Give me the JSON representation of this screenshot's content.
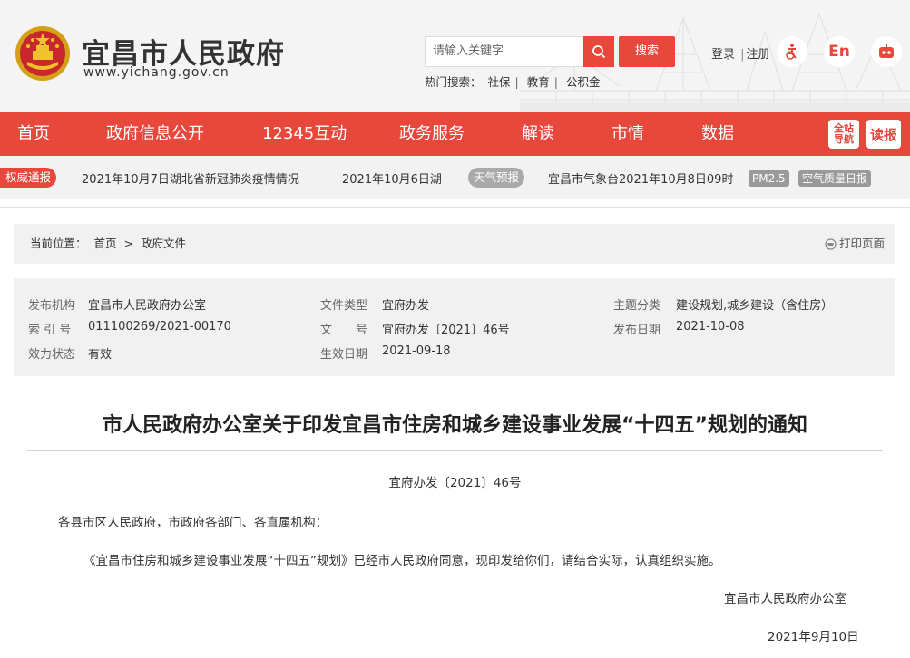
{
  "site": {
    "title": "宜昌市人民政府",
    "url": "www.yichang.gov.cn"
  },
  "search": {
    "placeholder": "请输入关键字",
    "button": "搜索"
  },
  "hot": {
    "label": "热门搜索：",
    "items": [
      "社保",
      "教育",
      "公积金"
    ]
  },
  "user": {
    "login": "登录",
    "divider": "|",
    "register": "注册",
    "lang_en": "En"
  },
  "nav": {
    "items": [
      "首页",
      "政府信息公开",
      "12345互动",
      "政务服务",
      "解读",
      "市情",
      "数据"
    ],
    "sitemap": "全站导航",
    "read": "读报"
  },
  "ticker": {
    "tag": "权威通报",
    "news1": "2021年10月7日湖北省新冠肺炎疫情情况",
    "news2": "2021年10月6日湖",
    "weather_tag": "天气预报",
    "weather_text": "宜昌市气象台2021年10月8日09时",
    "pm": "PM2.5",
    "aqi": "空气质量日报"
  },
  "breadcrumb": {
    "label": "当前位置：",
    "home": "首页",
    "sep": ">",
    "current": "政府文件",
    "print": "打印页面"
  },
  "meta": {
    "publisher_k": "发布机构",
    "publisher_v": "宜昌市人民政府办公室",
    "index_k": "索 引 号",
    "index_v": "011100269/2021-00170",
    "status_k": "效力状态",
    "status_v": "有效",
    "type_k": "文件类型",
    "type_v": "宜府办发",
    "docno_k": "文　　号",
    "docno_v": "宜府办发〔2021〕46号",
    "effective_k": "生效日期",
    "effective_v": "2021-09-18",
    "topic_k": "主题分类",
    "topic_v": "建设规划,城乡建设（含住房）",
    "pubdate_k": "发布日期",
    "pubdate_v": "2021-10-08"
  },
  "doc": {
    "title": "市人民政府办公室关于印发宜昌市住房和城乡建设事业发展“十四五”规划的通知",
    "number": "宜府办发〔2021〕46号",
    "salutation": "各县市区人民政府，市政府各部门、各直属机构：",
    "body": "《宜昌市住房和城乡建设事业发展“十四五”规划》已经市人民政府同意，现印发给你们，请结合实际，认真组织实施。",
    "signer": "宜昌市人民政府办公室",
    "date": "2021年9月10日"
  },
  "colors": {
    "brand_red": "#e8473c",
    "bg_gray": "#f1f1f1"
  }
}
